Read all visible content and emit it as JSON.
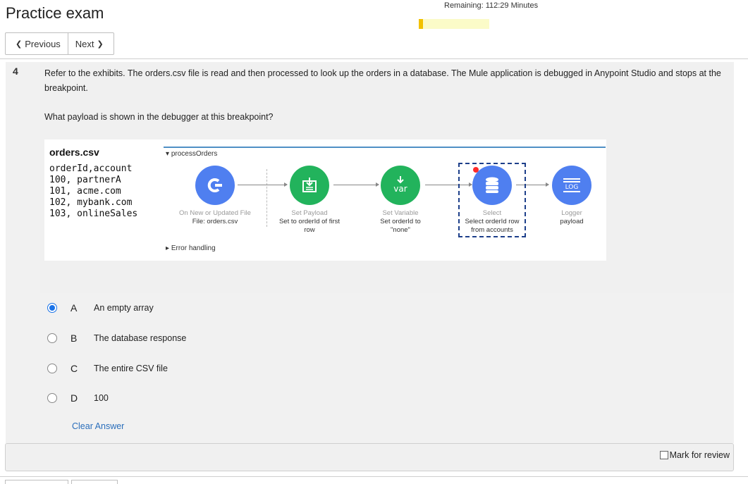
{
  "header": {
    "title": "Practice exam",
    "remaining_label": "Remaining: 112:29 Minutes",
    "time_progress_fraction": 0.06
  },
  "nav": {
    "previous_label": "Previous",
    "next_label": "Next"
  },
  "question": {
    "number": "4",
    "text": "Refer to the exhibits. The orders.csv file is read and then processed to look up the orders in a database. The Mule application is debugged in Anypoint Studio and stops at the breakpoint.",
    "prompt": "What payload is shown in the debugger at this breakpoint?"
  },
  "exhibit": {
    "csv_title": "orders.csv",
    "csv_lines": [
      "orderId,account",
      "100, partnerA",
      "101, acme.com",
      "102, mybank.com",
      "103, onlineSales"
    ],
    "flow_name": "processOrders",
    "error_handling": "Error handling",
    "nodes": [
      {
        "type": "On New or Updated File",
        "sub": "File: orders.csv",
        "icon": "file-listener-icon",
        "color": "#4f7ff0"
      },
      {
        "type": "Set Payload",
        "sub": "Set to orderId of first row",
        "icon": "set-payload-icon",
        "color": "#22b35c"
      },
      {
        "type": "Set Variable",
        "sub": "Set orderId to \"none\"",
        "icon": "set-variable-icon",
        "color": "#22b35c",
        "icon_text": "var"
      },
      {
        "type": "Select",
        "sub": "Select orderId row from accounts",
        "icon": "database-icon",
        "color": "#4f7ff0"
      },
      {
        "type": "Logger",
        "sub": "payload",
        "icon": "logger-icon",
        "color": "#4f7ff0",
        "icon_text": "LOG"
      }
    ]
  },
  "choices": [
    {
      "letter": "A",
      "text": "An empty array",
      "selected": true
    },
    {
      "letter": "B",
      "text": "The database response",
      "selected": false
    },
    {
      "letter": "C",
      "text": "The entire CSV file",
      "selected": false
    },
    {
      "letter": "D",
      "text": "100",
      "selected": false
    }
  ],
  "clear_answer_label": "Clear Answer",
  "mark_for_review_label": "Mark for review",
  "colors": {
    "accent": "#1a73e8",
    "link": "#2a6ebb",
    "timer_fill": "#f2c100",
    "timer_track": "#fbfbc8"
  }
}
